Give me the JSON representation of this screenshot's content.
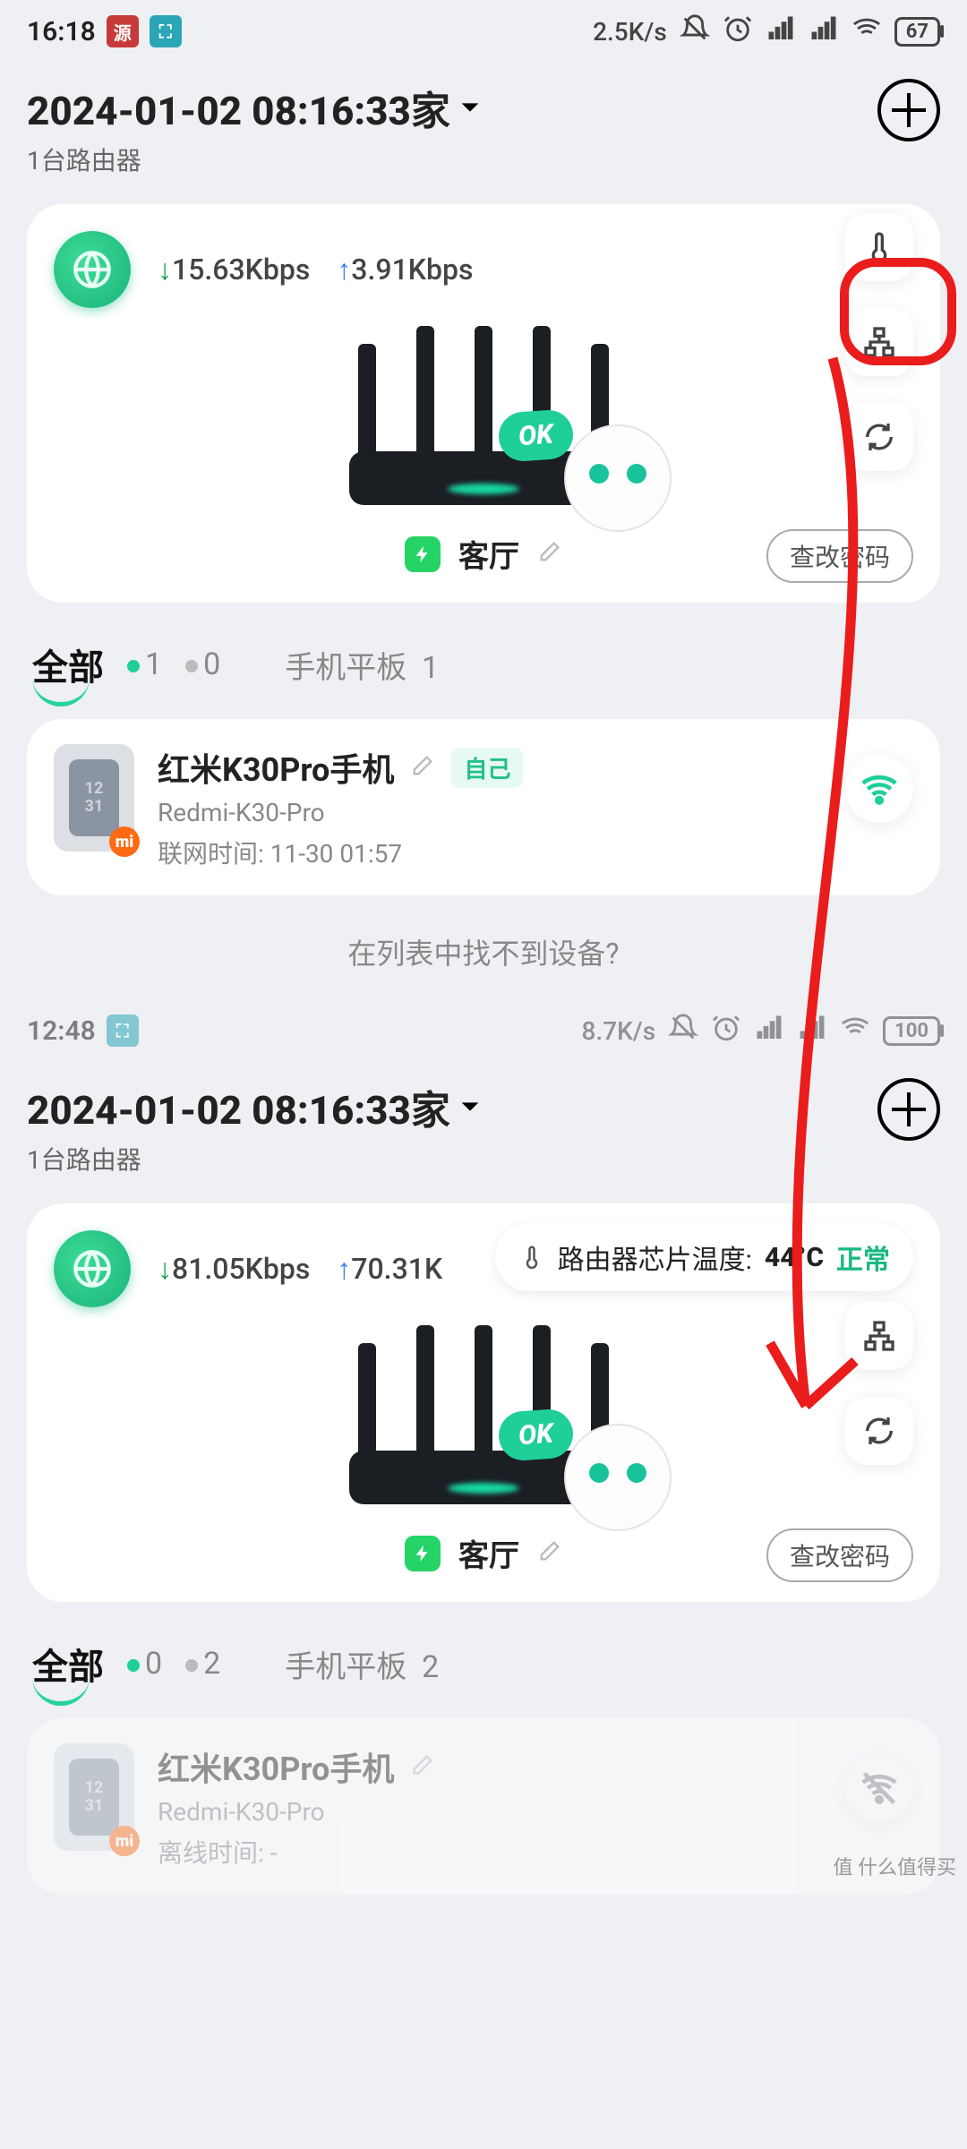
{
  "screen1": {
    "status": {
      "time": "16:18",
      "net_speed": "2.5K/s",
      "battery": "67"
    },
    "header": {
      "title": "2024-01-02 08:16:33家",
      "subtitle": "1台路由器"
    },
    "router": {
      "down": "15.63Kbps",
      "up": "3.91Kbps",
      "room": "客厅",
      "ok": "OK",
      "pwd_btn": "查改密码"
    },
    "filters": {
      "all_label": "全部",
      "green_count": "1",
      "gray_count": "0",
      "tab2_label": "手机平板",
      "tab2_count": "1"
    },
    "device": {
      "name": "红米K30Pro手机",
      "self_badge": "自己",
      "model": "Redmi-K30-Pro",
      "time_label": "联网时间: 11-30 01:57",
      "thumb_text": "12\n31"
    },
    "not_found": "在列表中找不到设备?"
  },
  "screen2": {
    "status": {
      "time": "12:48",
      "net_speed": "8.7K/s",
      "battery": "100"
    },
    "header": {
      "title": "2024-01-02 08:16:33家",
      "subtitle": "1台路由器"
    },
    "router": {
      "down": "81.05Kbps",
      "up": "70.31K",
      "room": "客厅",
      "ok": "OK",
      "pwd_btn": "查改密码"
    },
    "temp": {
      "label": "路由器芯片温度:",
      "value": "44°C",
      "state": "正常"
    },
    "filters": {
      "all_label": "全部",
      "green_count": "0",
      "gray_count": "2",
      "tab2_label": "手机平板",
      "tab2_count": "2"
    },
    "device": {
      "name": "红米K30Pro手机",
      "model": "Redmi-K30-Pro",
      "time_label": "离线时间: -",
      "thumb_text": "12\n31"
    }
  },
  "watermark": "值 什么值得买"
}
